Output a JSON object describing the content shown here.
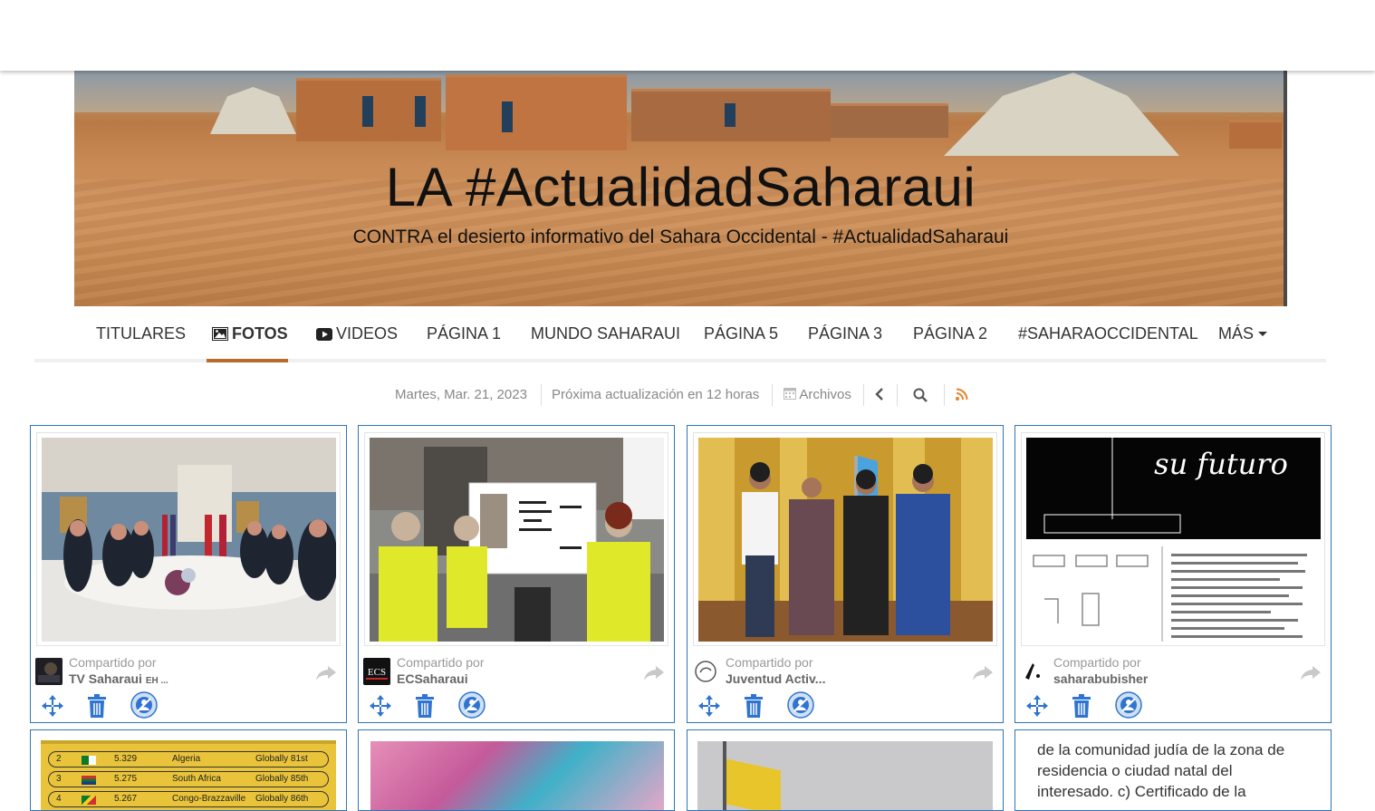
{
  "banner": {
    "title": "LA #ActualidadSaharaui",
    "subtitle": "CONTRA el desierto informativo del Sahara Occidental - #ActualidadSaharaui"
  },
  "nav": {
    "items": [
      {
        "label": "TITULARES"
      },
      {
        "label": "FOTOS",
        "icon": "image-icon"
      },
      {
        "label": "VIDEOS",
        "icon": "youtube-icon"
      },
      {
        "label": "PÁGINA 1"
      },
      {
        "label": "MUNDO SAHARAUI"
      },
      {
        "label": "PÁGINA 5"
      },
      {
        "label": "PÁGINA 3"
      },
      {
        "label": "PÁGINA 2"
      },
      {
        "label": "#SAHARAOCCIDENTAL"
      },
      {
        "label": "MÁS"
      }
    ],
    "accent_color": "#b86b2a"
  },
  "infobar": {
    "date": "Martes, Mar. 21, 2023",
    "next_update": "Próxima actualización en 12 horas",
    "archives": "Archivos"
  },
  "cards": [
    {
      "shared_label": "Compartido por",
      "author": "TV Saharaui",
      "author_suffix": "EH ...",
      "photo": "diplomatic-meeting"
    },
    {
      "shared_label": "Compartido por",
      "author": "ECSaharaui",
      "author_suffix": "",
      "photo": "protest-vests"
    },
    {
      "shared_label": "Compartido por",
      "author": "Juventud Activ...",
      "author_suffix": "",
      "photo": "group-portrait"
    },
    {
      "shared_label": "Compartido por",
      "author": "saharabubisher",
      "author_suffix": "",
      "photo": "library-flyer"
    }
  ],
  "flyer": {
    "heading": "su futuro"
  },
  "avatar_logo": "ECS",
  "bottom_cards": [
    {
      "rows": [
        {
          "rank": "2",
          "value": "5.329",
          "country": "Algeria",
          "global": "Globally 81st"
        },
        {
          "rank": "3",
          "value": "5.275",
          "country": "South Africa",
          "global": "Globally 85th"
        },
        {
          "rank": "4",
          "value": "5.267",
          "country": "Congo-Brazzaville",
          "global": "Globally 86th"
        }
      ]
    },
    {},
    {},
    {
      "text": "de la comunidad judía de la zona de residencia o ciudad natal del interesado. c) Certificado de la"
    }
  ],
  "colors": {
    "card_border": "#2f74b5",
    "action_blue": "#2f74d0"
  }
}
